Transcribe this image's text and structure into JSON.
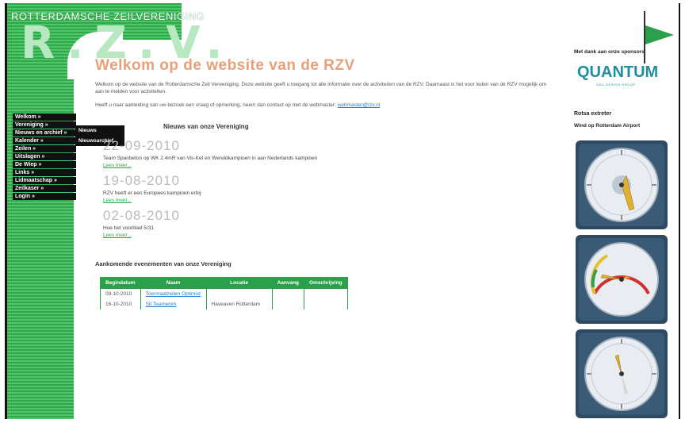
{
  "header": {
    "club_name": "ROTTERDAMSCHE ZEILVERENIGING",
    "logo": "R.Z.V."
  },
  "menu": {
    "items": [
      {
        "label": "Welkom »"
      },
      {
        "label": "Vereniging »"
      },
      {
        "label": "Nieuws en archief »"
      },
      {
        "label": "Kalender »"
      },
      {
        "label": "Zeilen »"
      },
      {
        "label": "Uitslagen »"
      },
      {
        "label": "De Wiep »"
      },
      {
        "label": "Links »"
      },
      {
        "label": "Lidmaatschap »"
      },
      {
        "label": "Zeilkaser »"
      },
      {
        "label": "Login »"
      }
    ],
    "submenu": [
      {
        "label": "Nieuws"
      },
      {
        "label": "Nieuwsarchief"
      }
    ]
  },
  "main": {
    "title": "Welkom op de website van de RZV",
    "intro": "Welkom op de website van de Rotterdamsche Zeil Vereeniging. Deze website geeft u toegang tot alle informatie over de activiteiten van de RZV. Daarnaast is het voor leden van de RZV mogelijk om aan te melden voor activiteiten.",
    "contact_text": "Heeft u naar aanleiding van uw bezoek een vraag of opmerking, neem dan contact op met de webmaster:",
    "contact_link": "webmaster@rzv.nl",
    "news_heading": "Nieuws van onze Vereniging",
    "news": [
      {
        "date": "22-09-2010",
        "text": "Team Spanbeton op WK 2.4mR van Vis-Ket en Wereldkampioen in aan Nederlands kampioen",
        "more": "Lees meer..."
      },
      {
        "date": "19-08-2010",
        "text": "RZV heeft er een Europees kampioen erbij",
        "more": "Lees meer..."
      },
      {
        "date": "02-08-2010",
        "text": "Hoe het voorblad 5/31",
        "more": "Lees meer..."
      }
    ],
    "events_heading": "Aankomende evenementen van onze Vereniging",
    "events_columns": [
      "Begindatum",
      "Naam",
      "Locatie",
      "Aanvang",
      "Omschrijving"
    ],
    "events": [
      {
        "date": "09-10-2010",
        "name": "Toermaalzeilen Optimist",
        "location": "",
        "start": "",
        "desc": ""
      },
      {
        "date": "16-10-2010",
        "name": "Sit Teamwork",
        "location": "Haveaven Rotterdam",
        "start": "",
        "desc": ""
      }
    ]
  },
  "right": {
    "sponsor_heading": "Met dank aan onze sponsors",
    "sponsor_name": "QUANTUM",
    "sponsor_sub": "SAIL DESIGN GROUP",
    "extern_heading": "Rotsa extreter",
    "wind_heading": "Wind op Rotterdam Airport"
  },
  "colors": {
    "green": "#2aa04a",
    "title_orange": "#e8a07a",
    "link_blue": "#2a7cc7",
    "gauge_bg": "#2e4a63"
  }
}
